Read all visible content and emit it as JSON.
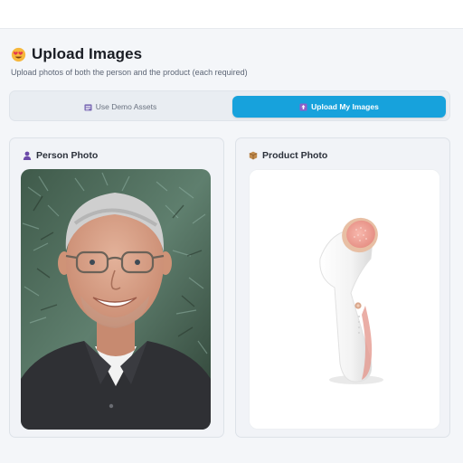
{
  "header": {
    "title": "Upload Images",
    "subtitle": "Upload photos of both the person and the product (each required)",
    "title_icon": "smiling-face-with-heart-eyes-icon"
  },
  "mode_toggle": {
    "options": [
      {
        "label": "Use Demo Assets",
        "icon": "folder-icon",
        "selected": false
      },
      {
        "label": "Upload My Images",
        "icon": "upload-icon",
        "selected": true
      }
    ]
  },
  "cards": {
    "person": {
      "title": "Person Photo",
      "icon": "person-icon"
    },
    "product": {
      "title": "Product Photo",
      "icon": "package-icon"
    }
  },
  "colors": {
    "accent": "#17a2dc",
    "background": "#f4f6f9",
    "card": "#f1f3f7"
  }
}
